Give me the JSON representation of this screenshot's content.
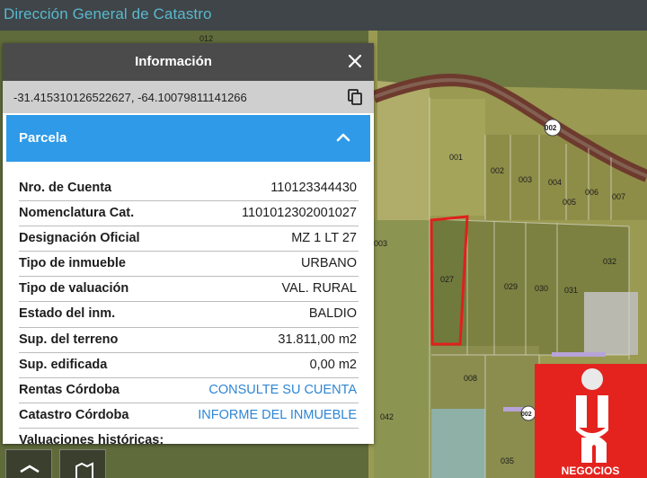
{
  "app": {
    "title": "Dirección General de Catastro"
  },
  "panel": {
    "title": "Información",
    "close_icon": "close-icon",
    "coordinates": "-31.415310126522627, -64.10079811141266",
    "copy_icon": "copy-icon"
  },
  "section": {
    "title": "Parcela",
    "toggle_icon": "chevron-up-icon"
  },
  "attributes": [
    {
      "label": "Nro. de Cuenta",
      "value": "110123344430"
    },
    {
      "label": "Nomenclatura Cat.",
      "value": "1101012302001027"
    },
    {
      "label": "Designación Oficial",
      "value": "MZ 1 LT 27"
    },
    {
      "label": "Tipo de inmueble",
      "value": "URBANO"
    },
    {
      "label": "Tipo de valuación",
      "value": "VAL. RURAL"
    },
    {
      "label": "Estado del inm.",
      "value": "BALDIO"
    },
    {
      "label": "Sup. del terreno",
      "value": "31.811,00 m2"
    },
    {
      "label": "Sup. edificada",
      "value": "0,00 m2"
    },
    {
      "label": "Rentas Córdoba",
      "value": "CONSULTE SU CUENTA"
    },
    {
      "label": "Catastro Córdoba",
      "value": "INFORME DEL INMUEBLE"
    },
    {
      "label": "Valuaciones históricas:",
      "value": ""
    }
  ],
  "map": {
    "parcel_labels": [
      "001",
      "002",
      "003",
      "004",
      "005",
      "006",
      "007",
      "003",
      "027",
      "029",
      "030",
      "031",
      "032",
      "042",
      "008",
      "035",
      "002",
      "012"
    ],
    "road_badge": "002",
    "highlight_color": "#e0201c"
  },
  "logo": {
    "text": "NEGOCIOS"
  },
  "colors": {
    "header_bg": "#3f4548",
    "title_color": "#59b8cf",
    "section_bg": "#2f9ae8",
    "link": "#2e86d4"
  }
}
